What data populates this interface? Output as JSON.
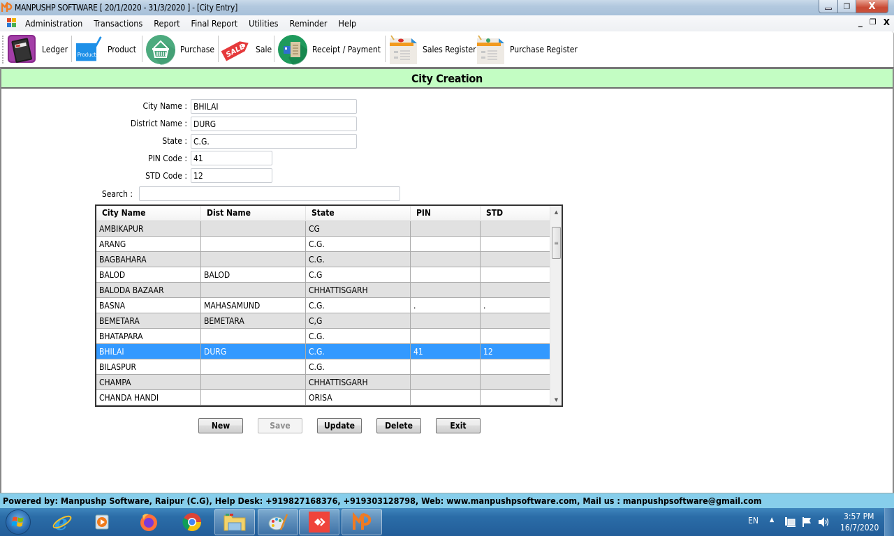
{
  "window": {
    "title": "MANPUSHP SOFTWARE [ 20/1/2020 - 31/3/2020 ]   - [City Entry]",
    "controls": {
      "minimize": "–",
      "maximize": "❐",
      "close": "X"
    }
  },
  "menubar": {
    "items": [
      "Administration",
      "Transactions",
      "Report",
      "Final Report",
      "Utilities",
      "Reminder",
      "Help"
    ],
    "mdi_controls": {
      "minimize": "_",
      "restore": "🗗",
      "close": "X"
    }
  },
  "toolbar": {
    "items": [
      {
        "label": "Ledger",
        "icon": "ledger-book-icon"
      },
      {
        "label": "Product",
        "icon": "products-check-icon"
      },
      {
        "label": "Purchase",
        "icon": "basket-icon"
      },
      {
        "label": "Sale",
        "icon": "sale-tag-icon"
      },
      {
        "label": "Receipt / Payment",
        "icon": "receipt-payment-icon"
      },
      {
        "label": "Sales Register",
        "icon": "register-icon"
      },
      {
        "label": "Purchase Register",
        "icon": "register-icon"
      }
    ],
    "product_icon_text": "Products",
    "sale_icon_text": "SALE"
  },
  "form": {
    "title": "City Creation",
    "fields": {
      "city_name": {
        "label": "City  Name :",
        "value": "BHILAI"
      },
      "district_name": {
        "label": "District  Name :",
        "value": "DURG"
      },
      "state": {
        "label": "State :",
        "value": "C.G."
      },
      "pin_code": {
        "label": "PIN Code :",
        "value": "41"
      },
      "std_code": {
        "label": "STD Code :",
        "value": "12"
      },
      "search": {
        "label": "Search :",
        "value": ""
      }
    }
  },
  "grid": {
    "columns": [
      "City Name",
      "Dist Name",
      "State",
      "PIN",
      "STD"
    ],
    "rows": [
      [
        "AMBIKAPUR",
        "",
        "CG",
        "",
        ""
      ],
      [
        "ARANG",
        "",
        "C.G.",
        "",
        ""
      ],
      [
        "BAGBAHARA",
        "",
        "C.G.",
        "",
        ""
      ],
      [
        "BALOD",
        "BALOD",
        "C.G",
        "",
        ""
      ],
      [
        "BALODA BAZAAR",
        "",
        "CHHATTISGARH",
        "",
        ""
      ],
      [
        "BASNA",
        "MAHASAMUND",
        "C.G.",
        ".",
        "."
      ],
      [
        "BEMETARA",
        "BEMETARA",
        "C,G",
        "",
        ""
      ],
      [
        "BHATAPARA",
        "",
        "C.G.",
        "",
        ""
      ],
      [
        "BHILAI",
        "DURG",
        "C.G.",
        "41",
        "12"
      ],
      [
        "BILASPUR",
        "",
        "C.G.",
        "",
        ""
      ],
      [
        "CHAMPA",
        "",
        "CHHATTISGARH",
        "",
        ""
      ],
      [
        "CHANDA HANDI",
        "",
        "ORISA",
        "",
        ""
      ]
    ],
    "selected_index": 8,
    "scroll_up": "▲",
    "scroll_down": "▼",
    "thumb_grip": "≡"
  },
  "buttons": {
    "new": "New",
    "save": "Save",
    "update": "Update",
    "delete": "Delete",
    "exit": "Exit"
  },
  "statusbar": {
    "text": "Powered by: Manpushp Software, Raipur (C.G), Help Desk: +919827168376, +919303128798, Web: www.manpushpsoftware.com,  Mail us :  manpushpsoftware@gmail.com"
  },
  "taskbar": {
    "apps": [
      "Internet Explorer",
      "Windows Media Player",
      "Firefox",
      "Chrome",
      "Windows Explorer",
      "Paint",
      "AnyDesk",
      "Manpushp Software"
    ],
    "tray": {
      "language": "EN",
      "time": "3:57 PM",
      "date": "16/7/2020"
    }
  },
  "colors": {
    "form_header_bg": "#c3fdc3",
    "selected_row_bg": "#3399ff",
    "alt_row_bg": "#e1e1e1",
    "statusbar_bg": "#87ceeb"
  }
}
